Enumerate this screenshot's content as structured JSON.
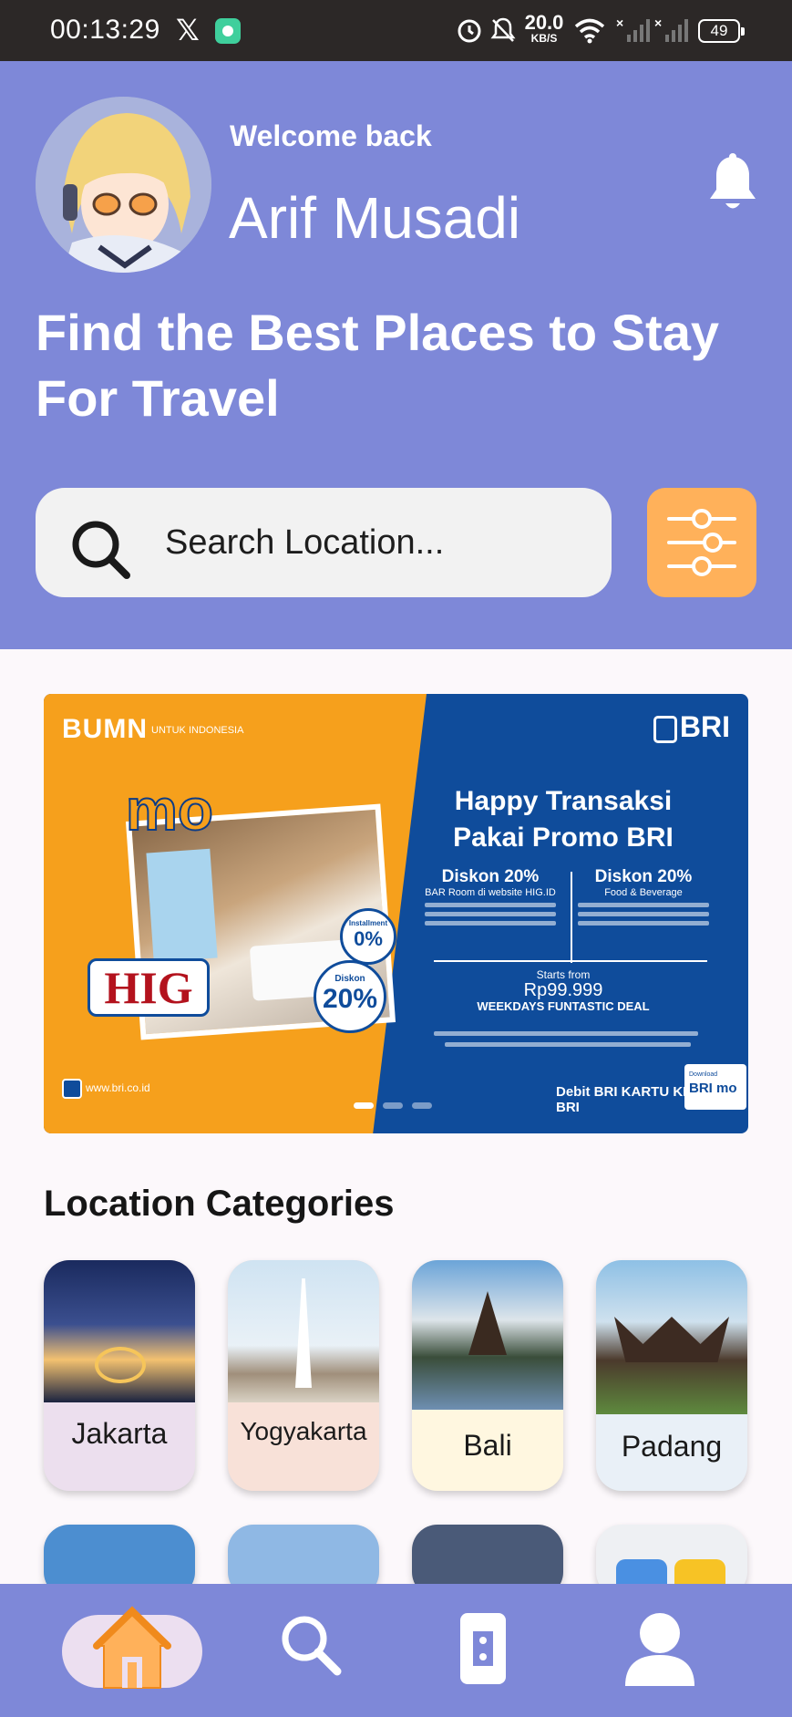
{
  "status_bar": {
    "time": "00:13:29",
    "net_speed_value": "20.0",
    "net_speed_unit": "KB/S",
    "battery": "49"
  },
  "header": {
    "welcome": "Welcome back",
    "username": "Arif Musadi",
    "headline": "Find the Best Places to Stay For Travel",
    "search_placeholder": "Search Location..."
  },
  "banner": {
    "bumn": "BUMN",
    "bumn_sub": "UNTUK INDONESIA",
    "bri": "BRI",
    "mo": "mo",
    "hig": "HIG",
    "installment_label": "Installment",
    "installment_value": "0%",
    "diskon_label": "Diskon",
    "diskon_value": "20%",
    "title_line1": "Happy Transaksi",
    "title_line2": "Pakai Promo BRI",
    "offer1_heading": "Diskon 20%",
    "offer1_sub": "BAR Room di website HIG.ID",
    "offer2_heading": "Diskon 20%",
    "offer2_sub": "Food & Beverage",
    "starts_from": "Starts from",
    "price": "Rp99.999",
    "deal": "WEEKDAYS FUNTASTIC DEAL",
    "debit": "Debit BRI  KARTU KREDIT BRI",
    "download": "Download",
    "download_app": "BRI mo",
    "website": "www.bri.co.id",
    "slide_count": 3,
    "active_slide": 1
  },
  "categories": {
    "title": "Location Categories",
    "items": [
      {
        "label": "Jakarta"
      },
      {
        "label": "Yogyakarta"
      },
      {
        "label": "Bali"
      },
      {
        "label": "Padang"
      }
    ]
  },
  "colors": {
    "primary": "#7e88d8",
    "filter_button": "#ffb15a",
    "home_active": "#ffb15a",
    "status_bar": "#2c2827"
  },
  "nav": {
    "items": [
      "home-icon",
      "search-icon",
      "ticket-icon",
      "profile-icon"
    ],
    "active": "home-icon"
  }
}
